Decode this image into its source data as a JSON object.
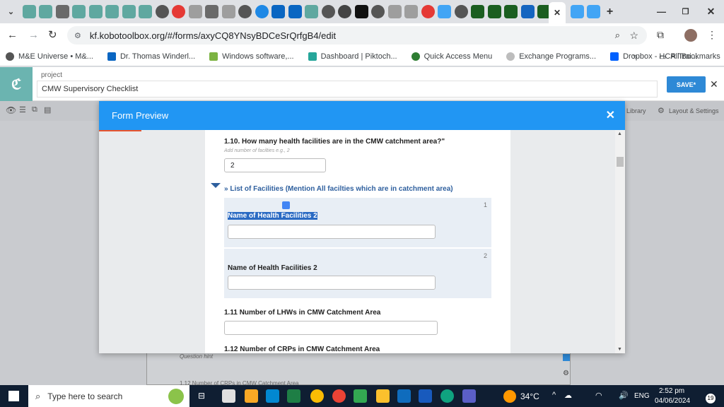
{
  "browser": {
    "url": "kf.kobotoolbox.org/#/forms/axyCQ8YNsyBDCeSrQrfgB4/edit",
    "bookmarks": [
      "M&E Universe • M&...",
      "Dr. Thomas Winderl...",
      "Windows software,...",
      "Dashboard | Piktoch...",
      "Quick Access Menu",
      "Exchange Programs...",
      "Dropbox - HCR Trai..."
    ],
    "all_bookmarks": "All Bookmarks"
  },
  "kobo": {
    "project_label": "project",
    "project_name": "CMW  Supervisory Checklist",
    "save_label": "SAVE",
    "library_label": "Library",
    "layout_label": "Layout & Settings",
    "bg_hint": "Question hint",
    "bg_question": "1.12 Number of CRPs in CMW Catchment Area"
  },
  "modal": {
    "title": "Form Preview",
    "q110": "1.10. How many health facilities are in the CMW catchment area?\"",
    "q110_hint": "Add number of facilties e.g., 2",
    "q110_value": "2",
    "group_label": "» List of Facilities (Mention All facilties which are in catchment area)",
    "rep1_num": "1",
    "rep1_label": "Name of Health Facilities 2",
    "rep2_num": "2",
    "rep2_label": "Name of Health Facilities 2",
    "q111": "1.11 Number of LHWs in CMW Catchment Area",
    "q112": "1.12 Number of CRPs in CMW Catchment Area"
  },
  "taskbar": {
    "search_placeholder": "Type here to search",
    "temperature": "34°C",
    "lang": "ENG",
    "time": "2:52 pm",
    "date": "04/06/2024",
    "notif": "19"
  }
}
